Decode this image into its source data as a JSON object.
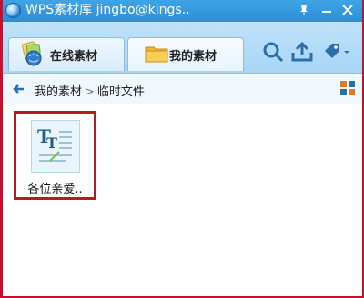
{
  "window": {
    "title": "WPS素材库  jingbo@kings..",
    "controls": [
      "pin-icon",
      "minimize-icon",
      "close-icon"
    ]
  },
  "tabs": [
    {
      "label": "在线素材",
      "icon": "online-globe-icon",
      "active": false
    },
    {
      "label": "我的素材",
      "icon": "folder-icon",
      "active": true
    }
  ],
  "toolbar": {
    "icons": [
      "search-icon",
      "upload-icon",
      "tag-dropdown-icon"
    ]
  },
  "breadcrumb": {
    "items": [
      "我的素材",
      "临时文件"
    ],
    "separator": ">"
  },
  "files": [
    {
      "name": "各位亲爱..",
      "icon": "text-document-icon"
    }
  ],
  "colors": {
    "titlebar": "#2a8fd6",
    "tabbar": "#a8d5f6",
    "highlight": "#b51c22",
    "window_border": "#c8102e"
  }
}
